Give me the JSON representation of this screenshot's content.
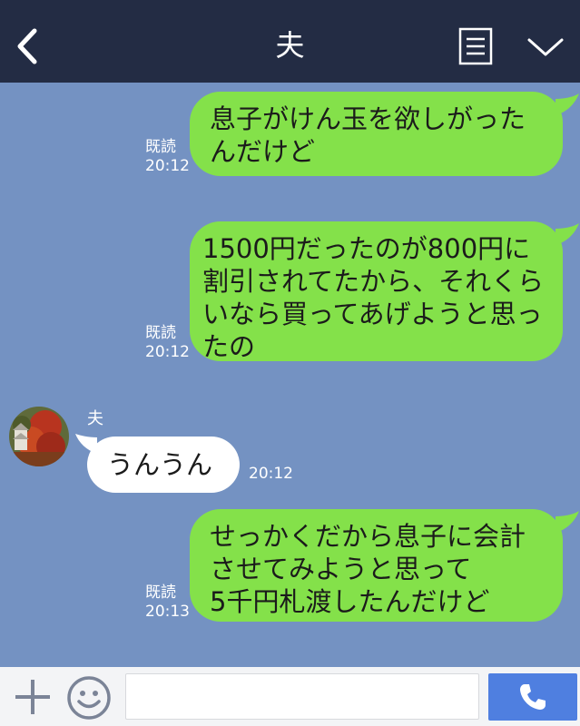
{
  "header": {
    "title": "夫",
    "back_icon": "chevron-left-icon",
    "menu_icon": "notes-menu-icon",
    "expand_icon": "chevron-down-icon",
    "bg_color": "#232c44"
  },
  "chat": {
    "bg_color": "#7492c2",
    "messages": [
      {
        "from": "me",
        "text": "息子がけん玉を欲しがった\nんだけど",
        "read": "既読",
        "time": "20:12"
      },
      {
        "from": "me",
        "text": "1500円だったのが800円に\n割引されてたから、それくら\nいなら買ってあげようと思っ\nたの",
        "read": "既読",
        "time": "20:12"
      },
      {
        "from": "other",
        "sender": "夫",
        "text": "うんうん",
        "time": "20:12"
      },
      {
        "from": "me",
        "text": "せっかくだから息子に会計\nさせてみようと思って\n5千円札渡したんだけど",
        "read": "既読",
        "time": "20:13"
      }
    ],
    "outgoing_color": "#84e14a",
    "incoming_color": "#ffffff"
  },
  "bottom_bar": {
    "plus_icon": "plus-icon",
    "emoji_icon": "smiley-icon",
    "input_value": "",
    "input_placeholder": "",
    "call_icon": "phone-icon",
    "call_button_color": "#4f7fe0"
  }
}
